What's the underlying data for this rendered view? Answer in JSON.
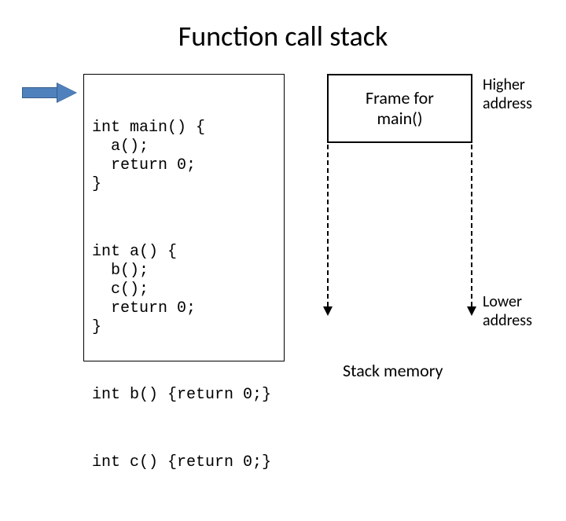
{
  "title": "Function call stack",
  "code": {
    "fn_main": "int main() {\n  a();\n  return 0;\n}",
    "fn_a": "int a() {\n  b();\n  c();\n  return 0;\n}",
    "fn_b": "int b() {return 0;}",
    "fn_c": "int c() {return 0;}"
  },
  "frame_label": "Frame for\nmain()",
  "addr_high": "Higher\naddress",
  "addr_low": "Lower\naddress",
  "stack_caption": "Stack memory"
}
